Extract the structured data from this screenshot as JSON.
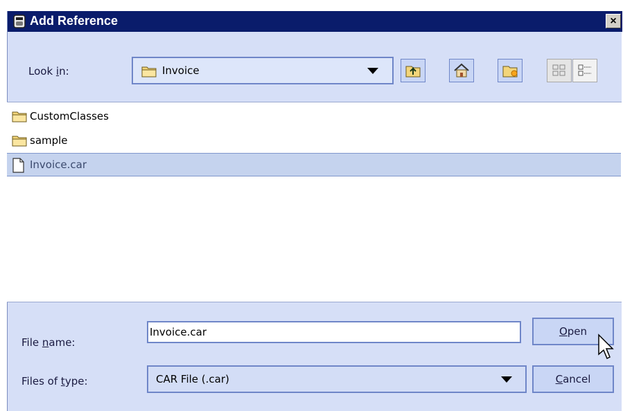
{
  "dialog": {
    "title": "Add Reference",
    "close_glyph": "×"
  },
  "toolbar": {
    "look_in_prefix": "Look ",
    "look_in_mnemonic": "i",
    "look_in_suffix": "n:",
    "location": "Invoice",
    "buttons": [
      {
        "icon": "up-one-level-icon",
        "enabled": true
      },
      {
        "icon": "home-icon",
        "enabled": true
      },
      {
        "icon": "new-folder-icon",
        "enabled": true
      },
      {
        "icon": "list-view-icon",
        "enabled": false
      },
      {
        "icon": "details-view-icon",
        "enabled": false
      }
    ]
  },
  "files": [
    {
      "name": "CustomClasses",
      "type": "folder",
      "selected": false
    },
    {
      "name": "sample",
      "type": "folder",
      "selected": false
    },
    {
      "name": "Invoice.car",
      "type": "file",
      "selected": true
    }
  ],
  "file_name": {
    "label_prefix": "File ",
    "label_mnemonic": "n",
    "label_suffix": "ame:",
    "value": "Invoice.car"
  },
  "file_type": {
    "label_prefix": "Files of ",
    "label_mnemonic": "t",
    "label_suffix": "ype:",
    "value": "CAR File (.car)"
  },
  "buttons": {
    "open_mnemonic": "O",
    "open_rest": "pen",
    "cancel_mnemonic": "C",
    "cancel_rest": "ancel"
  },
  "colors": {
    "title_bar": "#0a1c6b",
    "dialog_bg": "#d6dff7",
    "accent_border": "#6f86c8",
    "selection": "#c5d3ee"
  }
}
